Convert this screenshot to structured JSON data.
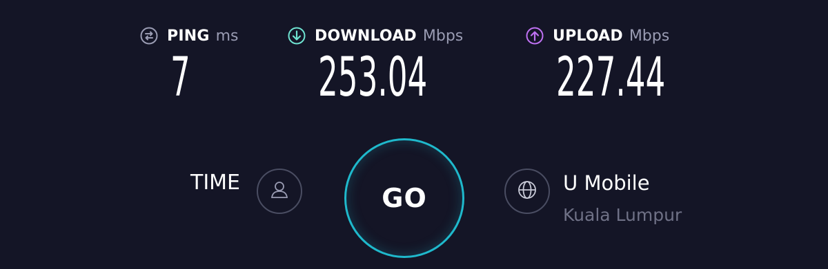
{
  "metrics": {
    "ping": {
      "label": "PING",
      "unit": "ms",
      "value": "7"
    },
    "download": {
      "label": "DOWNLOAD",
      "unit": "Mbps",
      "value": "253.04"
    },
    "upload": {
      "label": "UPLOAD",
      "unit": "Mbps",
      "value": "227.44"
    }
  },
  "time_label": "TIME",
  "go_label": "GO",
  "server": {
    "isp": "U Mobile",
    "location": "Kuala Lumpur"
  },
  "icons": {
    "ping": "ping-icon",
    "download": "download-arrow-icon",
    "upload": "upload-arrow-icon",
    "user": "user-icon",
    "globe": "globe-icon"
  },
  "colors": {
    "background": "#141526",
    "download_accent": "#6fe3d1",
    "upload_accent": "#bf71f2",
    "go_ring": "#1fb9cc",
    "unit_text": "#9a9cb3",
    "muted_text": "#6f7186"
  }
}
